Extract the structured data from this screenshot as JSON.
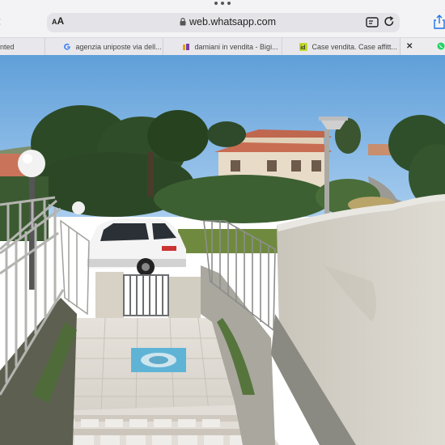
{
  "browser": {
    "more_label": "•••",
    "text_size_label": "AA",
    "url": "web.whatsapp.com",
    "tabs": [
      {
        "label": "nted",
        "favicon": "page-icon"
      },
      {
        "label": "agenzia uniposte via dell...",
        "favicon": "google-g-icon"
      },
      {
        "label": "damiani in vendita - Bigi...",
        "favicon": "bigi-icon"
      },
      {
        "label": "Case vendita. Case affitt...",
        "favicon": "idealista-icon"
      }
    ],
    "close_tab_label": "✕"
  },
  "colors": {
    "sky": "#6aa8e0",
    "foliage": "#2f4a2a",
    "wall": "#cfccc2",
    "railing": "#a9aaa6",
    "tile_accent": "#58b6d8"
  },
  "photo": {
    "subject": "outdoor-stairway-photo"
  }
}
